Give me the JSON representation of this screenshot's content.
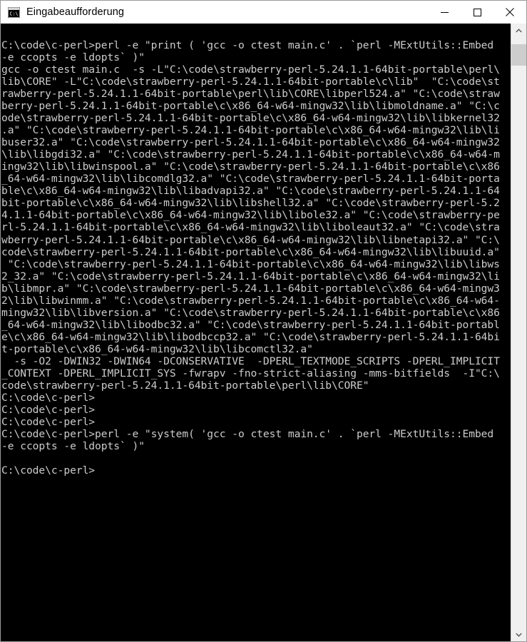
{
  "window": {
    "title": "Eingabeaufforderung",
    "icon": "console-icon",
    "background_color": "#000000",
    "text_color": "#cccccc",
    "titlebar_color": "#ffffff"
  },
  "caption_buttons": {
    "minimize": {
      "name": "minimize-button",
      "glyph": "minimize-icon"
    },
    "maximize": {
      "name": "maximize-button",
      "glyph": "maximize-icon"
    },
    "close": {
      "name": "close-button",
      "glyph": "close-icon"
    }
  },
  "scrollbar": {
    "up_arrow_label": "scroll-up",
    "down_arrow_label": "scroll-down",
    "thumb_label": "scrollbar-thumb"
  },
  "console": {
    "prompt": "C:\\code\\c-perl>",
    "columns": 80,
    "lines": [
      "C:\\code\\c-perl>perl -e \"print ( 'gcc -o ctest main.c' . `perl -MExtUtils::Embed",
      "-e ccopts -e ldopts` )\"",
      "gcc -o ctest main.c  -s -L\"C:\\code\\strawberry-perl-5.24.1.1-64bit-portable\\perl\\",
      "lib\\CORE\" -L\"C:\\code\\strawberry-perl-5.24.1.1-64bit-portable\\c\\lib\"  \"C:\\code\\st",
      "rawberry-perl-5.24.1.1-64bit-portable\\perl\\lib\\CORE\\libperl524.a\" \"C:\\code\\straw",
      "berry-perl-5.24.1.1-64bit-portable\\c\\x86_64-w64-mingw32\\lib\\libmoldname.a\" \"C:\\c",
      "ode\\strawberry-perl-5.24.1.1-64bit-portable\\c\\x86_64-w64-mingw32\\lib\\libkernel32",
      ".a\" \"C:\\code\\strawberry-perl-5.24.1.1-64bit-portable\\c\\x86_64-w64-mingw32\\lib\\li",
      "buser32.a\" \"C:\\code\\strawberry-perl-5.24.1.1-64bit-portable\\c\\x86_64-w64-mingw32",
      "\\lib\\libgdi32.a\" \"C:\\code\\strawberry-perl-5.24.1.1-64bit-portable\\c\\x86_64-w64-m",
      "ingw32\\lib\\libwinspool.a\" \"C:\\code\\strawberry-perl-5.24.1.1-64bit-portable\\c\\x86",
      "_64-w64-mingw32\\lib\\libcomdlg32.a\" \"C:\\code\\strawberry-perl-5.24.1.1-64bit-porta",
      "ble\\c\\x86_64-w64-mingw32\\lib\\libadvapi32.a\" \"C:\\code\\strawberry-perl-5.24.1.1-64",
      "bit-portable\\c\\x86_64-w64-mingw32\\lib\\libshell32.a\" \"C:\\code\\strawberry-perl-5.2",
      "4.1.1-64bit-portable\\c\\x86_64-w64-mingw32\\lib\\libole32.a\" \"C:\\code\\strawberry-pe",
      "rl-5.24.1.1-64bit-portable\\c\\x86_64-w64-mingw32\\lib\\liboleaut32.a\" \"C:\\code\\stra",
      "wberry-perl-5.24.1.1-64bit-portable\\c\\x86_64-w64-mingw32\\lib\\libnetapi32.a\" \"C:\\",
      "code\\strawberry-perl-5.24.1.1-64bit-portable\\c\\x86_64-w64-mingw32\\lib\\libuuid.a\"",
      " \"C:\\code\\strawberry-perl-5.24.1.1-64bit-portable\\c\\x86_64-w64-mingw32\\lib\\libws",
      "2_32.a\" \"C:\\code\\strawberry-perl-5.24.1.1-64bit-portable\\c\\x86_64-w64-mingw32\\li",
      "b\\libmpr.a\" \"C:\\code\\strawberry-perl-5.24.1.1-64bit-portable\\c\\x86_64-w64-mingw3",
      "2\\lib\\libwinmm.a\" \"C:\\code\\strawberry-perl-5.24.1.1-64bit-portable\\c\\x86_64-w64-",
      "mingw32\\lib\\libversion.a\" \"C:\\code\\strawberry-perl-5.24.1.1-64bit-portable\\c\\x86",
      "_64-w64-mingw32\\lib\\libodbc32.a\" \"C:\\code\\strawberry-perl-5.24.1.1-64bit-portabl",
      "e\\c\\x86_64-w64-mingw32\\lib\\libodbccp32.a\" \"C:\\code\\strawberry-perl-5.24.1.1-64bi",
      "t-portable\\c\\x86_64-w64-mingw32\\lib\\libcomctl32.a\"",
      "  -s -O2 -DWIN32 -DWIN64 -DCONSERVATIVE  -DPERL_TEXTMODE_SCRIPTS -DPERL_IMPLICIT",
      "_CONTEXT -DPERL_IMPLICIT_SYS -fwrapv -fno-strict-aliasing -mms-bitfields  -I\"C:\\",
      "code\\strawberry-perl-5.24.1.1-64bit-portable\\perl\\lib\\CORE\"",
      "C:\\code\\c-perl>",
      "C:\\code\\c-perl>",
      "C:\\code\\c-perl>",
      "C:\\code\\c-perl>perl -e \"system( 'gcc -o ctest main.c' . `perl -MExtUtils::Embed",
      "-e ccopts -e ldopts` )\"",
      "",
      "C:\\code\\c-perl>"
    ]
  }
}
